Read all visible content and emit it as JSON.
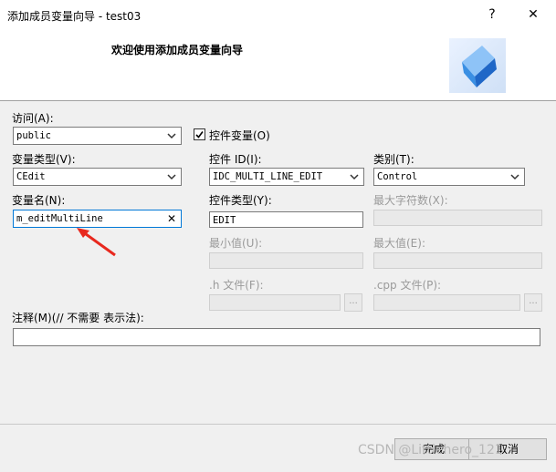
{
  "window": {
    "title": "添加成员变量向导 - test03",
    "help_icon": "?",
    "close_icon": "✕"
  },
  "header": {
    "title": "欢迎使用添加成员变量向导",
    "logo_icon": "cube-logo-icon"
  },
  "access": {
    "label": "访问(A):",
    "value": "public"
  },
  "control_variable": {
    "label": "控件变量(O)",
    "checked": true
  },
  "variable_type": {
    "label": "变量类型(V):",
    "value": "CEdit"
  },
  "control_id": {
    "label": "控件 ID(I):",
    "value": "IDC_MULTI_LINE_EDIT"
  },
  "category": {
    "label": "类别(T):",
    "value": "Control"
  },
  "variable_name": {
    "label": "变量名(N):",
    "value": "m_editMultiLine",
    "clear_icon": "✕"
  },
  "control_type": {
    "label": "控件类型(Y):",
    "value": "EDIT"
  },
  "max_chars": {
    "label": "最大字符数(X):",
    "value": ""
  },
  "min_value": {
    "label": "最小值(U):",
    "value": ""
  },
  "max_value": {
    "label": "最大值(E):",
    "value": ""
  },
  "h_file": {
    "label": ".h 文件(F):",
    "value": "",
    "browse_label": "..."
  },
  "cpp_file": {
    "label": ".cpp 文件(P):",
    "value": "",
    "browse_label": "..."
  },
  "comment": {
    "label": "注释(M)(// 不需要 表示法):",
    "value": ""
  },
  "buttons": {
    "finish": "完成",
    "cancel": "取消"
  },
  "watermark": "CSDN @Littlehero_121"
}
